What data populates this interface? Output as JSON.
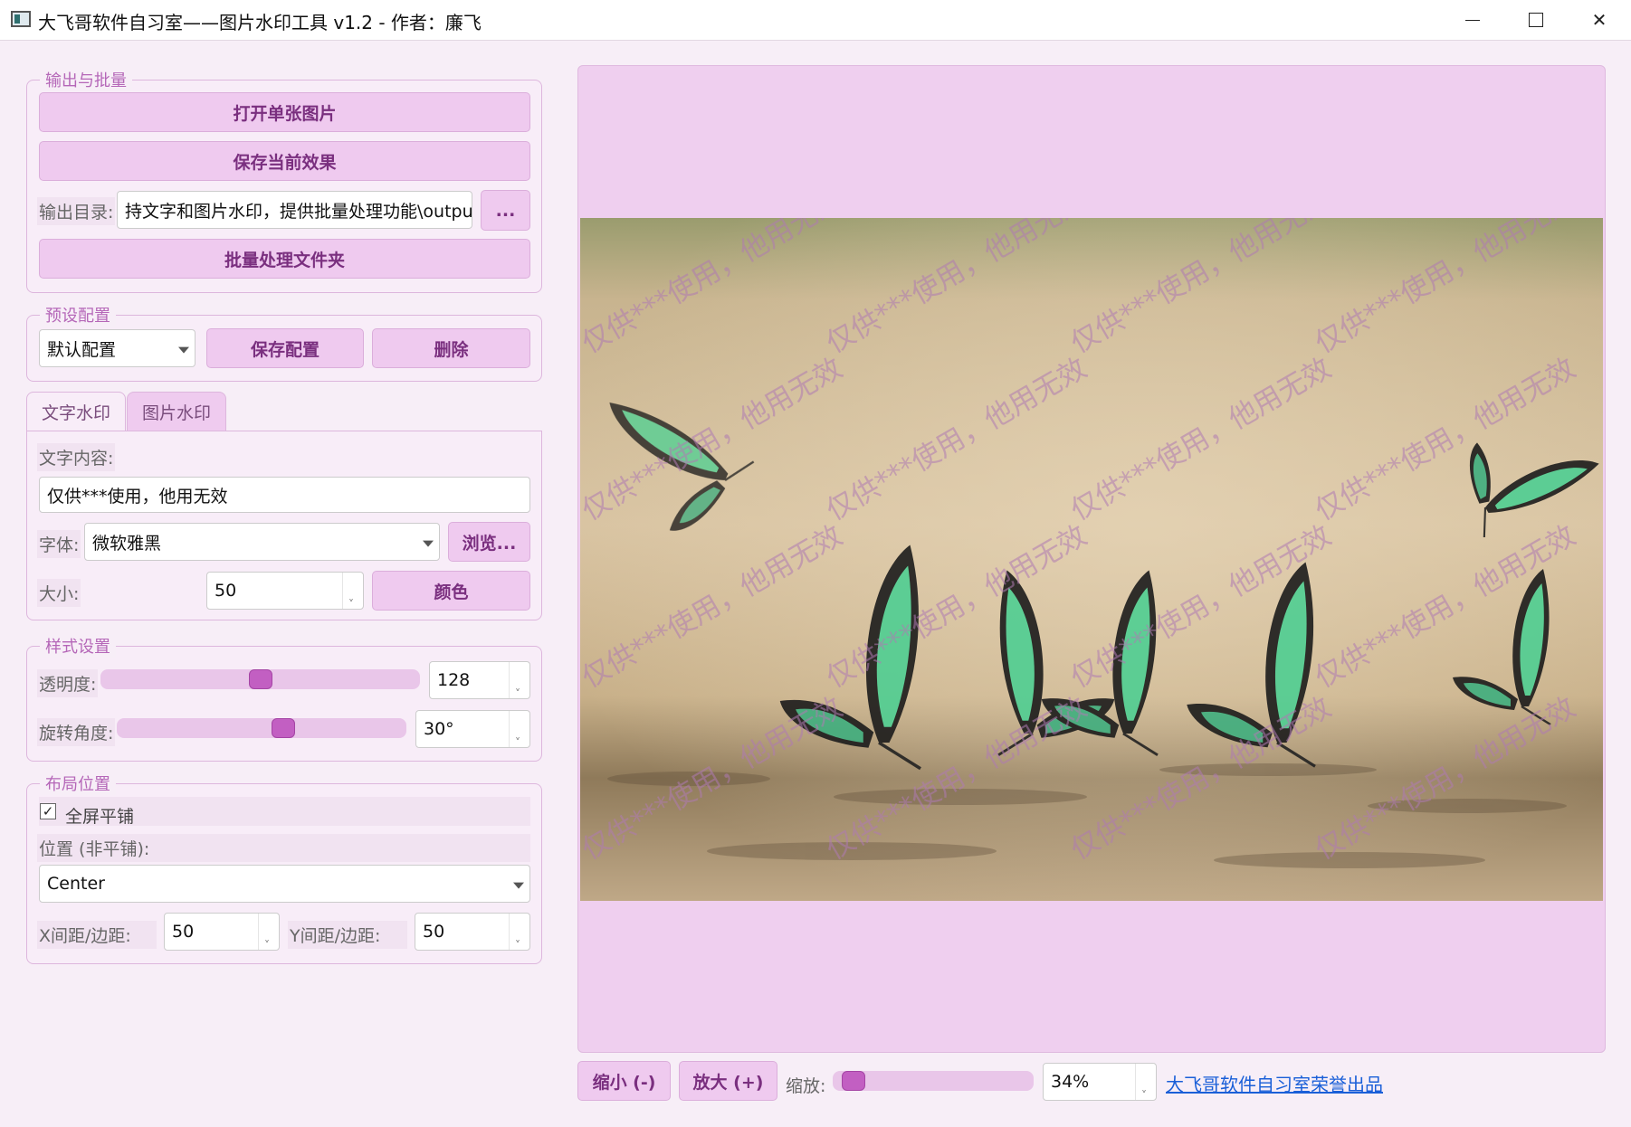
{
  "window": {
    "title": "大飞哥软件自习室——图片水印工具 v1.2 - 作者：廉飞"
  },
  "output_group": {
    "legend": "输出与批量",
    "open_single": "打开单张图片",
    "save_current": "保存当前效果",
    "output_dir_label": "输出目录:",
    "output_dir_value": "持文字和图片水印，提供批量处理功能\\output",
    "browse_dir": "...",
    "batch_folder": "批量处理文件夹"
  },
  "preset_group": {
    "legend": "预设配置",
    "selected_preset": "默认配置",
    "save_preset": "保存配置",
    "delete_preset": "删除"
  },
  "tabs": [
    {
      "label": "文字水印",
      "active": true
    },
    {
      "label": "图片水印",
      "active": false
    }
  ],
  "text_tab": {
    "content_label": "文字内容:",
    "content_value": "仅供***使用，他用无效",
    "font_label": "字体:",
    "font_value": "微软雅黑",
    "browse_font": "浏览...",
    "size_label": "大小:",
    "size_value": "50",
    "color_button": "颜色"
  },
  "style_group": {
    "legend": "样式设置",
    "opacity_label": "透明度:",
    "opacity_value": "128",
    "opacity_fraction": 0.5,
    "rotation_label": "旋转角度:",
    "rotation_value": "30°",
    "rotation_fraction": 0.58
  },
  "layout_group": {
    "legend": "布局位置",
    "tile_label": "全屏平铺",
    "tile_checked": true,
    "position_label": "位置 (非平铺):",
    "position_value": "Center",
    "x_label": "X间距/边距:",
    "x_value": "50",
    "y_label": "Y间距/边距:",
    "y_value": "50"
  },
  "preview": {
    "watermark_text": "仅供***使用，他用无效"
  },
  "bottom_bar": {
    "zoom_out": "缩小 (-)",
    "zoom_in": "放大 (+)",
    "zoom_label": "缩放:",
    "zoom_value": "34%",
    "zoom_fraction": 0.05,
    "credit_link": "大飞哥软件自习室荣誉出品"
  },
  "colors": {
    "accent": "#c25fc2",
    "button_bg": "#efcaef",
    "preview_bg": "#efcfef",
    "link": "#1a5fd8"
  }
}
